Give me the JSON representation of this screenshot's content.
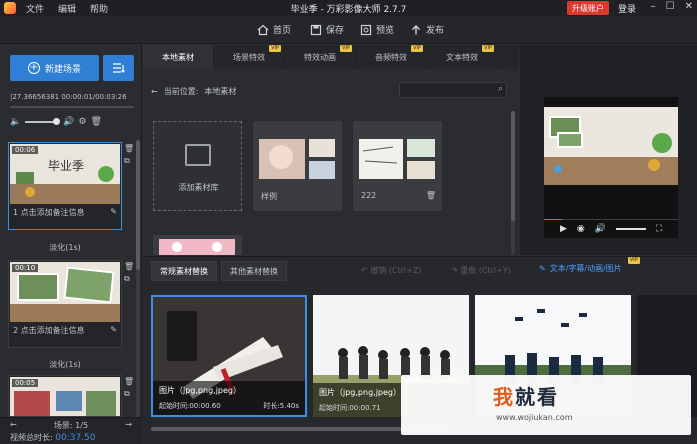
{
  "titlebar": {
    "title": "毕业季 - 万彩影像大师 2.7.7",
    "menu": [
      "文件",
      "编辑",
      "帮助"
    ],
    "upgrade": "升级账户",
    "login": "登录"
  },
  "toolbar": {
    "home": "首页",
    "save": "保存",
    "preview": "预览",
    "publish": "发布"
  },
  "left": {
    "new_scene": "新建场景",
    "timeline": "|27.36656381 00:00:01/00:03:26",
    "scenes": [
      {
        "time": "00:06",
        "note": "1  点击添加备注信息",
        "transition": "淡化(1s)"
      },
      {
        "time": "00:10",
        "note": "2  点击添加备注信息",
        "transition": "淡化(1s)"
      },
      {
        "time": "00:05",
        "note": "",
        "transition": ""
      }
    ],
    "pager": "场景: 1/5",
    "total_label": "视频总时长:",
    "total_value": "00:37.50"
  },
  "library": {
    "tabs": [
      {
        "label": "本地素材",
        "vip": ""
      },
      {
        "label": "场景特效",
        "vip": "VIP"
      },
      {
        "label": "特效动画",
        "vip": "VIP"
      },
      {
        "label": "音频特效",
        "vip": "VIP"
      },
      {
        "label": "文本特效",
        "vip": "VIP"
      }
    ],
    "location_label": "当前位置:",
    "location_value": "本地素材",
    "add_library": "添加素材库",
    "folders": [
      "样例",
      "222"
    ]
  },
  "replace": {
    "tab_regular": "常规素材替换",
    "tab_other": "其他素材替换",
    "undo": "撤销 (Ctrl+Z)",
    "redo": "重做 (Ctrl+Y)",
    "text_effect": "文本/字幕/动画/图片",
    "vip": "VIP",
    "clips": [
      {
        "type": "图片（jpg,png,jpeg）",
        "start": "起始时间:00:00.60",
        "duration": "时长:5.40s"
      },
      {
        "type": "图片（jpg,png,jpeg）",
        "start": "起始时间:00:00.71",
        "duration": ""
      },
      {
        "type": "",
        "start": "",
        "duration": ""
      }
    ]
  },
  "thumbnail_texts": {
    "scene1_title": "毕业季"
  },
  "watermark": {
    "big_a": "我",
    "big_b": "就看",
    "small": "www.wojiukan.com"
  },
  "colors": {
    "accent": "#2f7fd4",
    "upgrade": "#d83b2e",
    "vip": "#e8c24a",
    "link": "#4ba0ff"
  }
}
